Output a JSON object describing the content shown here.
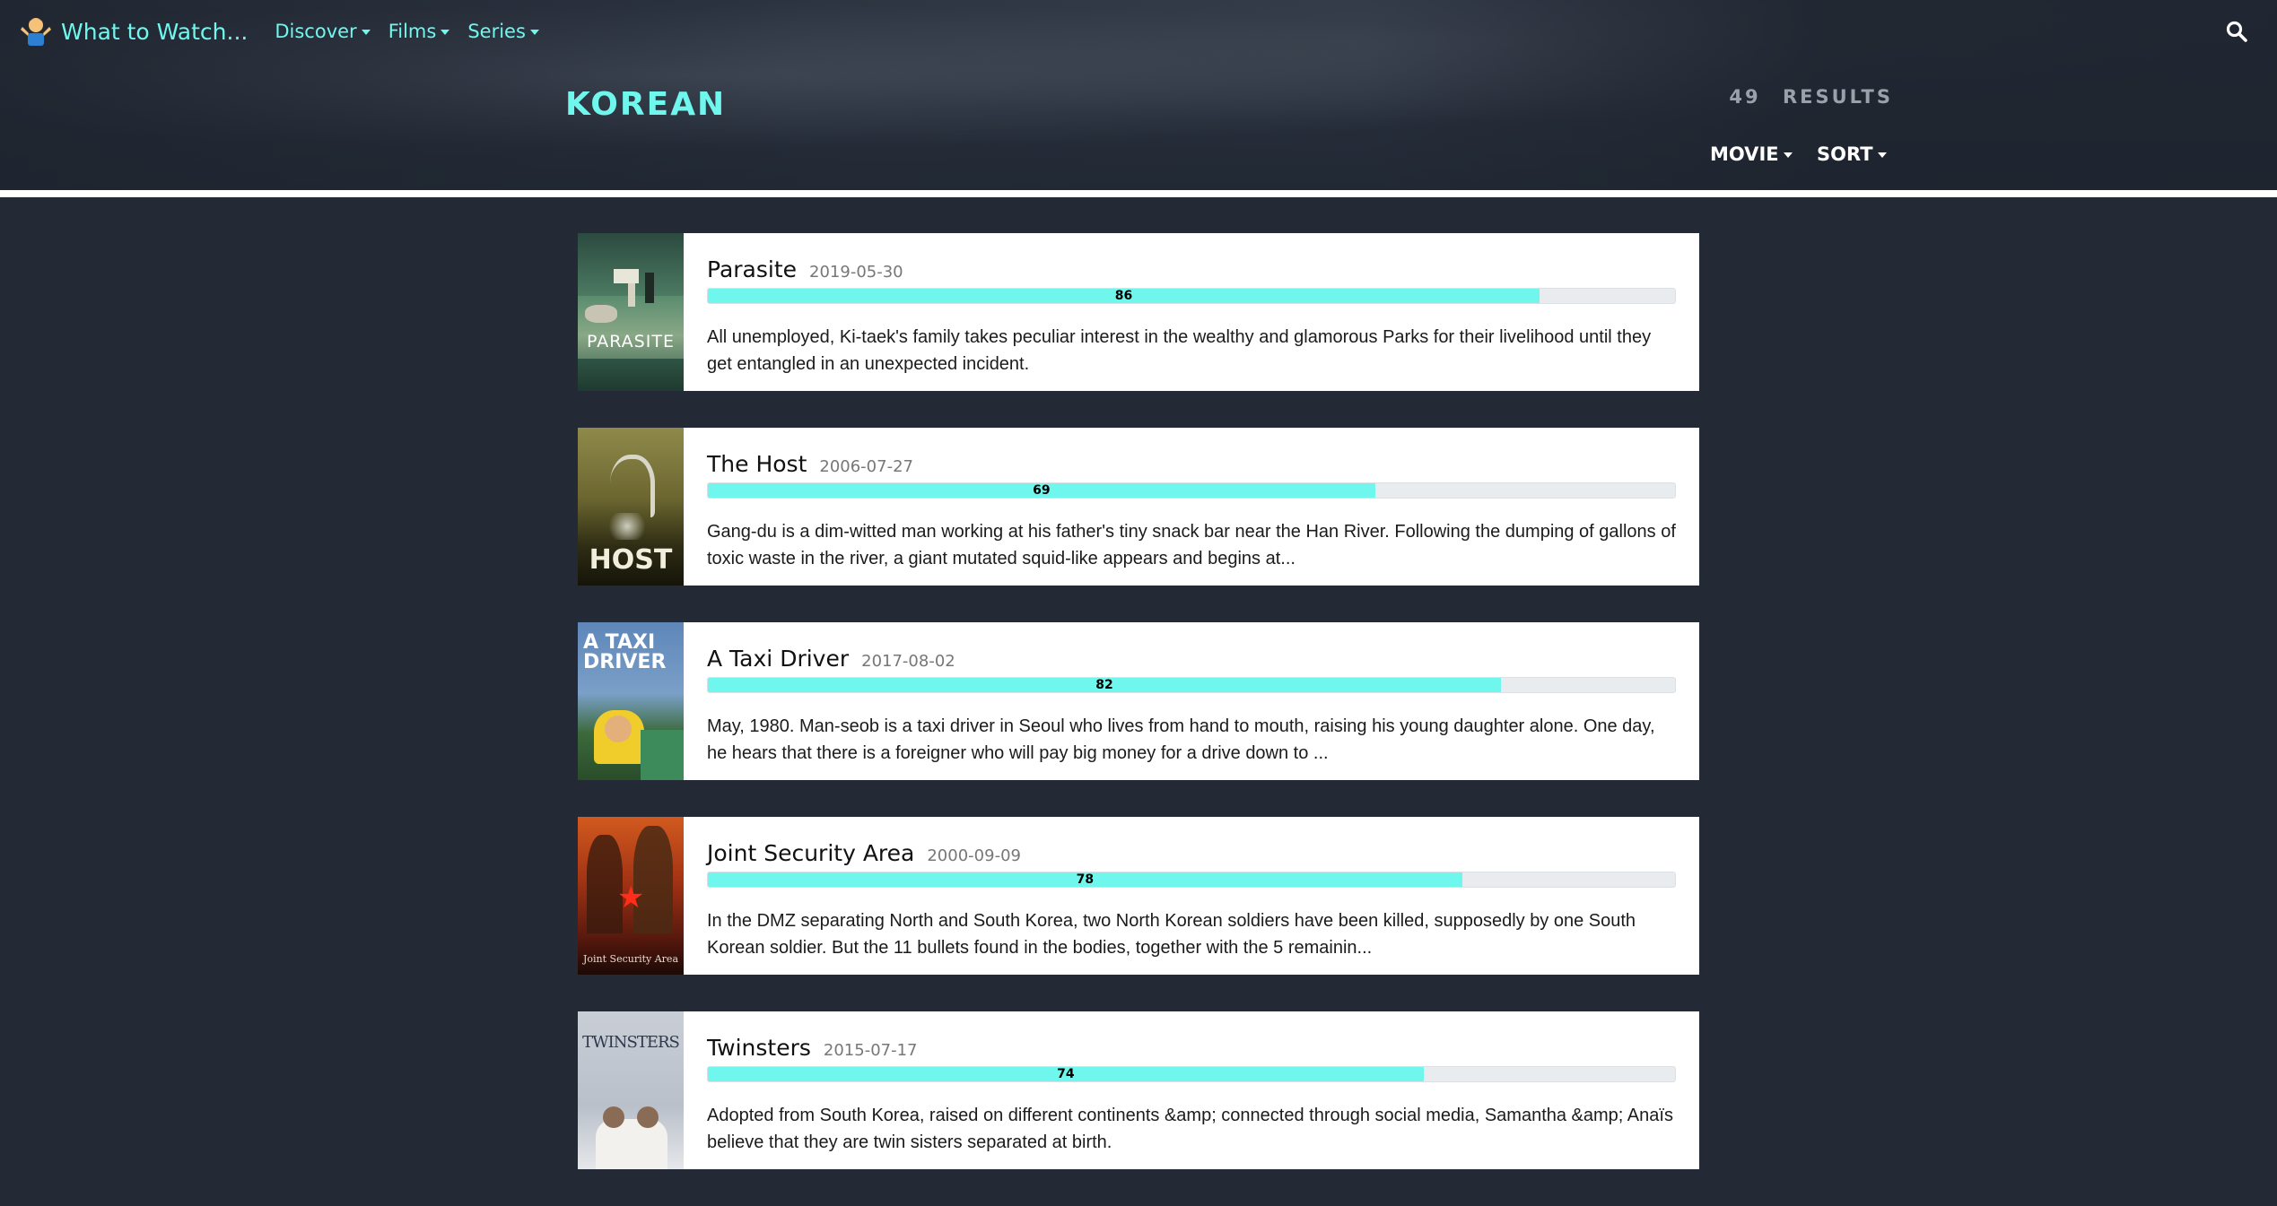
{
  "nav": {
    "brand": "What to Watch...",
    "items": [
      {
        "label": "Discover"
      },
      {
        "label": "Films"
      },
      {
        "label": "Series"
      }
    ],
    "search_icon": "search-icon"
  },
  "header": {
    "title": "KOREAN",
    "results_count": "49",
    "results_label": "RESULTS",
    "filter_type": "MOVIE",
    "sort_label": "SORT"
  },
  "movies": [
    {
      "title": "Parasite",
      "date": "2019-05-30",
      "rating": 86,
      "rating_label": "86",
      "poster_text": "PARASITE",
      "overview": "All unemployed, Ki-taek's family takes peculiar interest in the wealthy and glamorous Parks for their livelihood until they get entangled in an unexpected incident."
    },
    {
      "title": "The Host",
      "date": "2006-07-27",
      "rating": 69,
      "rating_label": "69",
      "poster_text": "HOST",
      "overview": "Gang-du is a dim-witted man working at his father's tiny snack bar near the Han River. Following the dumping of gallons of toxic waste in the river, a giant mutated squid-like appears and begins at..."
    },
    {
      "title": "A Taxi Driver",
      "date": "2017-08-02",
      "rating": 82,
      "rating_label": "82",
      "poster_text": "A TAXI DRIVER",
      "overview": "May, 1980. Man-seob is a taxi driver in Seoul who lives from hand to mouth, raising his young daughter alone. One day, he hears that there is a foreigner who will pay big money for a drive down to ..."
    },
    {
      "title": "Joint Security Area",
      "date": "2000-09-09",
      "rating": 78,
      "rating_label": "78",
      "poster_text": "Joint Security Area",
      "overview": "In the DMZ separating North and South Korea, two North Korean soldiers have been killed, supposedly by one South Korean soldier. But the 11 bullets found in the bodies, together with the 5 remainin..."
    },
    {
      "title": "Twinsters",
      "date": "2015-07-17",
      "rating": 74,
      "rating_label": "74",
      "poster_text": "TWINSTERS",
      "overview": "Adopted from South Korea, raised on different continents &amp; connected through social media, Samantha &amp; Anaïs believe that they are twin sisters separated at birth."
    }
  ]
}
